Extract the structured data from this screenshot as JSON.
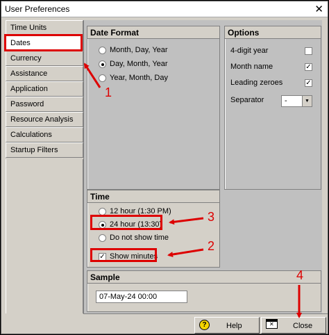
{
  "window": {
    "title": "User Preferences",
    "close_glyph": "✕"
  },
  "nav": {
    "items": [
      {
        "label": "Time Units",
        "selected": false
      },
      {
        "label": "Dates",
        "selected": true
      },
      {
        "label": "Currency",
        "selected": false
      },
      {
        "label": "Assistance",
        "selected": false
      },
      {
        "label": "Application",
        "selected": false
      },
      {
        "label": "Password",
        "selected": false
      },
      {
        "label": "Resource Analysis",
        "selected": false
      },
      {
        "label": "Calculations",
        "selected": false
      },
      {
        "label": "Startup Filters",
        "selected": false
      }
    ]
  },
  "date_format": {
    "title": "Date Format",
    "options": [
      {
        "label": "Month, Day, Year",
        "checked": false
      },
      {
        "label": "Day, Month, Year",
        "checked": true
      },
      {
        "label": "Year, Month, Day",
        "checked": false
      }
    ]
  },
  "options": {
    "title": "Options",
    "four_digit_year": {
      "label": "4-digit year",
      "checked": false
    },
    "month_name": {
      "label": "Month name",
      "checked": true
    },
    "leading_zeroes": {
      "label": "Leading zeroes",
      "checked": true
    },
    "separator": {
      "label": "Separator",
      "value": "-"
    }
  },
  "time": {
    "title": "Time",
    "options": [
      {
        "label": "12 hour (1:30 PM)",
        "checked": false
      },
      {
        "label": "24 hour (13:30)",
        "checked": true
      },
      {
        "label": "Do not show time",
        "checked": false
      }
    ],
    "show_minutes": {
      "label": "Show minutes",
      "checked": true
    }
  },
  "sample": {
    "title": "Sample",
    "value": "07-May-24 00:00"
  },
  "buttons": {
    "help": "Help",
    "help_icon": "?",
    "close": "Close"
  },
  "annotations": {
    "n1": "1",
    "n2": "2",
    "n3": "3",
    "n4": "4",
    "color": "#dd0000"
  },
  "icons": {
    "check": "✓",
    "dropdown": "▼"
  }
}
